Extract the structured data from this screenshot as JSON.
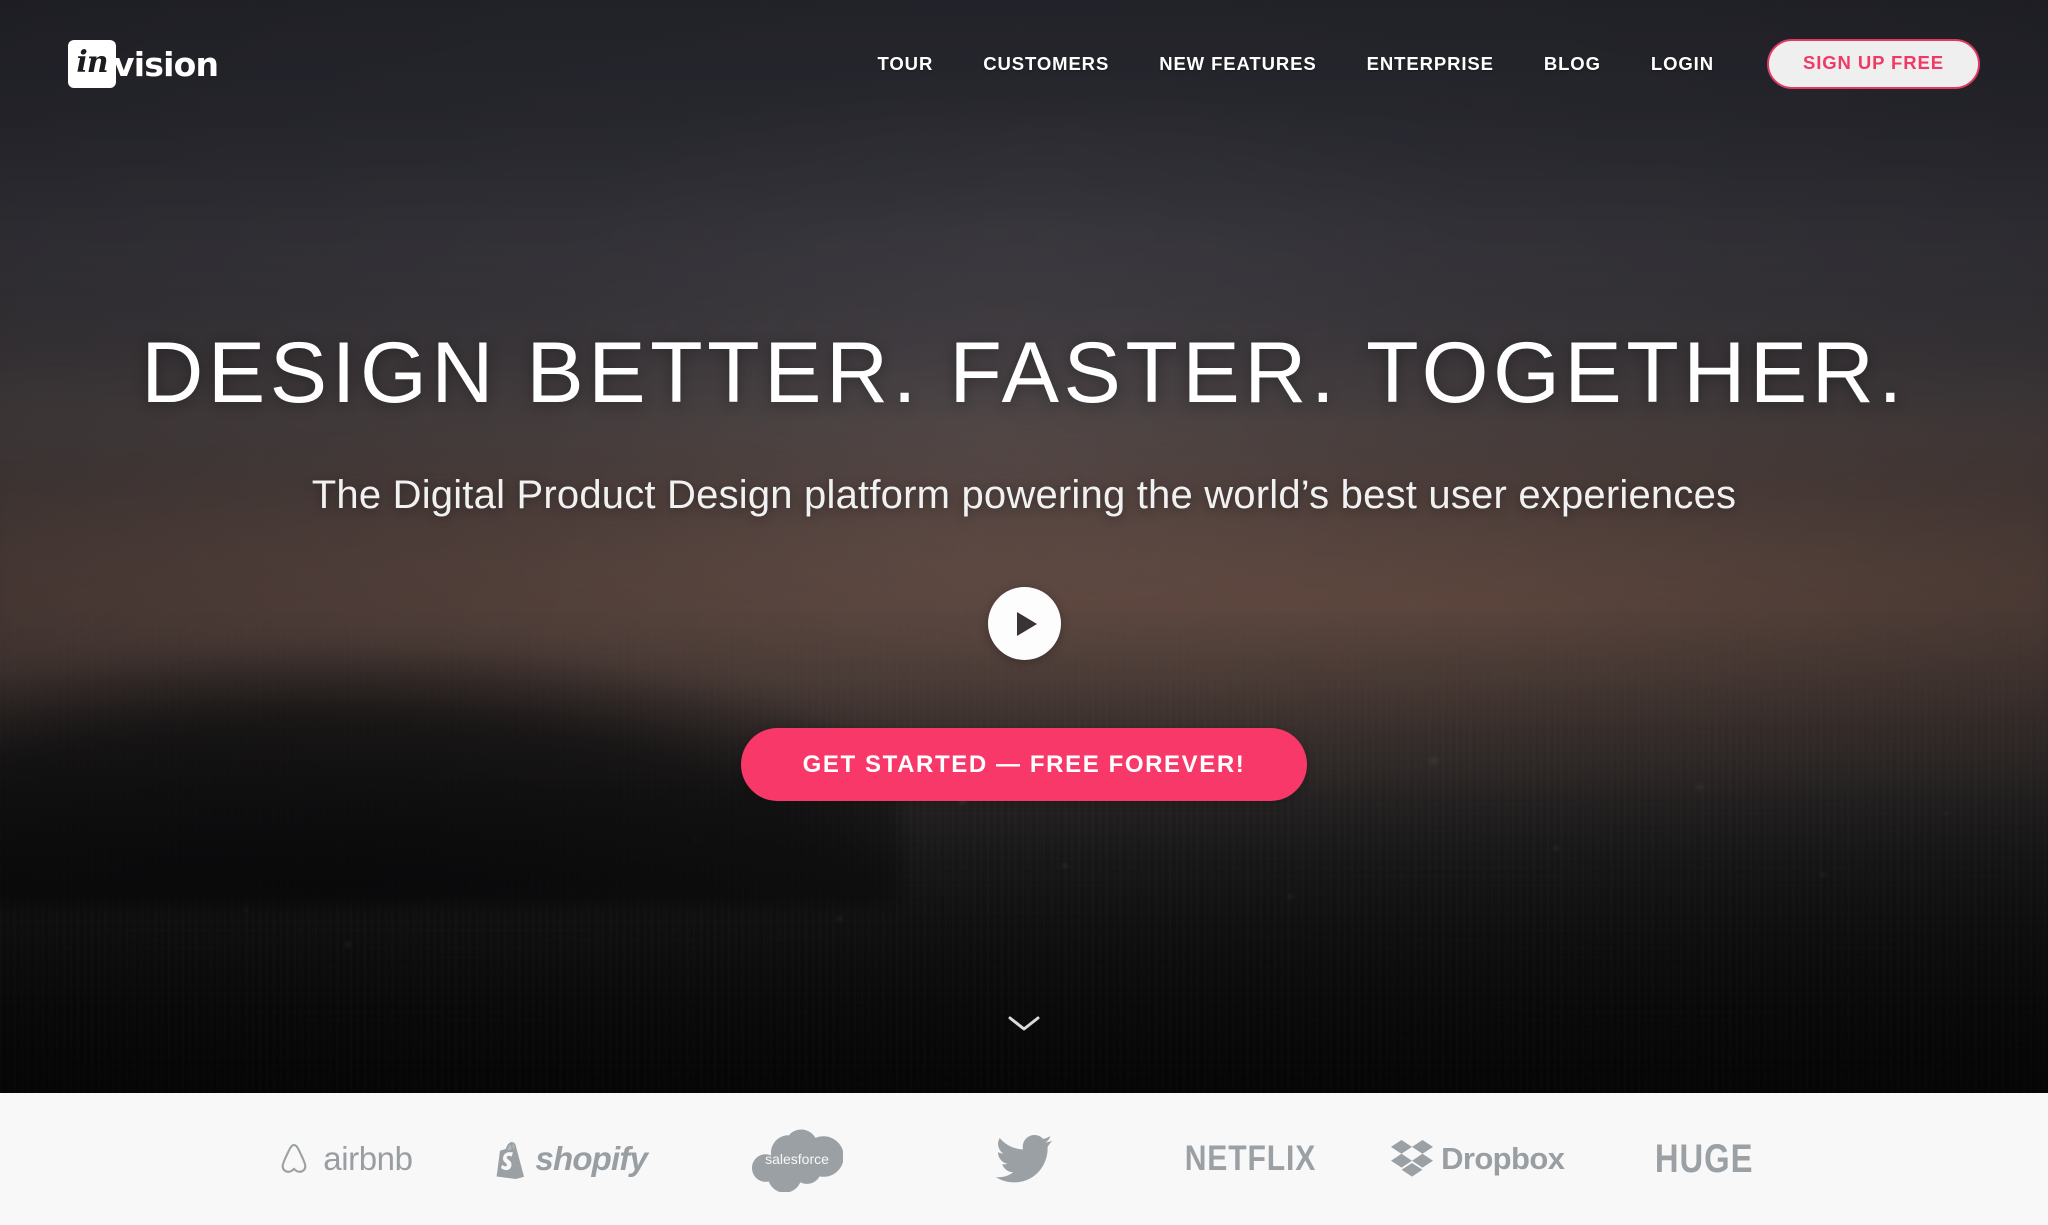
{
  "brand": {
    "logo_mark_text": "in",
    "logo_word_text": "vision",
    "logo_name": "invision-logo"
  },
  "nav": {
    "links": [
      {
        "label": "TOUR",
        "name": "nav-link-tour"
      },
      {
        "label": "CUSTOMERS",
        "name": "nav-link-customers"
      },
      {
        "label": "NEW FEATURES",
        "name": "nav-link-new-features"
      },
      {
        "label": "ENTERPRISE",
        "name": "nav-link-enterprise"
      },
      {
        "label": "BLOG",
        "name": "nav-link-blog"
      },
      {
        "label": "LOGIN",
        "name": "nav-link-login"
      }
    ],
    "signup_label": "SIGN UP FREE"
  },
  "hero": {
    "headline": "DESIGN BETTER. FASTER. TOGETHER.",
    "subheadline": "The Digital Product Design platform powering the world’s best user experiences",
    "play_icon": "play-icon",
    "cta_label": "GET STARTED — FREE FOREVER!",
    "scroll_icon": "chevron-down-icon"
  },
  "logobar": {
    "brands": [
      {
        "label": "airbnb",
        "icon": "airbnb-belo-icon",
        "name": "brand-logo-airbnb"
      },
      {
        "label": "shopify",
        "icon": "shopify-bag-icon",
        "name": "brand-logo-shopify"
      },
      {
        "label": "salesforce",
        "icon": "salesforce-cloud-icon",
        "name": "brand-logo-salesforce"
      },
      {
        "label": "",
        "icon": "twitter-bird-icon",
        "name": "brand-logo-twitter"
      },
      {
        "label": "NETFLIX",
        "icon": "",
        "name": "brand-logo-netflix"
      },
      {
        "label": "Dropbox",
        "icon": "dropbox-box-icon",
        "name": "brand-logo-dropbox"
      },
      {
        "label": "HUGE",
        "icon": "",
        "name": "brand-logo-huge"
      }
    ]
  },
  "colors": {
    "accent_pink": "#f9386a",
    "nav_cta_pink": "#ef3a66",
    "hero_dark": "#2f3038",
    "logobar_bg": "#f8f8f8",
    "brand_gray": "#9aa0a4"
  }
}
